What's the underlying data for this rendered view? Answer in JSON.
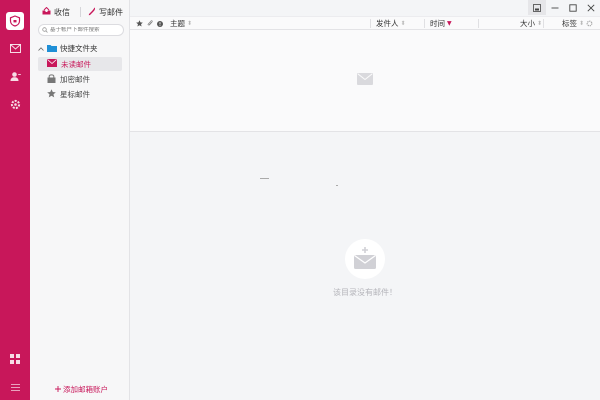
{
  "toolbar": {
    "receive_label": "收信",
    "write_label": "写邮件"
  },
  "search": {
    "placeholder": "基于帐户下邮件搜索"
  },
  "folders": {
    "group_label": "快捷文件夹",
    "items": [
      {
        "label": "未读邮件",
        "icon": "mail-unread-icon"
      },
      {
        "label": "加密邮件",
        "icon": "lock-icon"
      },
      {
        "label": "星标邮件",
        "icon": "star-icon"
      }
    ]
  },
  "add_account_label": "添加邮箱账户",
  "list_header": {
    "subject": "主题",
    "from": "发件人",
    "time": "时间",
    "size": "大小",
    "tag": "标签"
  },
  "empty_message": "该目录没有邮件！",
  "colors": {
    "accent": "#c8175a",
    "panel_bg": "#f7f7f8",
    "main_bg": "#f4f5f7"
  }
}
